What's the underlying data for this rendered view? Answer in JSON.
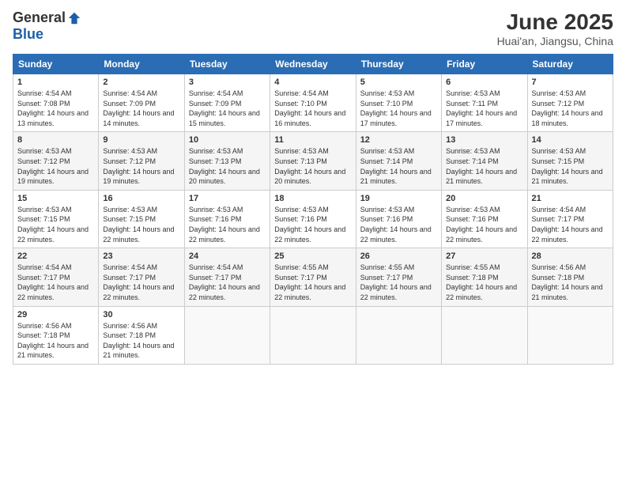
{
  "logo": {
    "general": "General",
    "blue": "Blue"
  },
  "title": "June 2025",
  "location": "Huai'an, Jiangsu, China",
  "days_of_week": [
    "Sunday",
    "Monday",
    "Tuesday",
    "Wednesday",
    "Thursday",
    "Friday",
    "Saturday"
  ],
  "weeks": [
    [
      {
        "day": "1",
        "sunrise": "4:54 AM",
        "sunset": "7:08 PM",
        "daylight": "14 hours and 13 minutes."
      },
      {
        "day": "2",
        "sunrise": "4:54 AM",
        "sunset": "7:09 PM",
        "daylight": "14 hours and 14 minutes."
      },
      {
        "day": "3",
        "sunrise": "4:54 AM",
        "sunset": "7:09 PM",
        "daylight": "14 hours and 15 minutes."
      },
      {
        "day": "4",
        "sunrise": "4:54 AM",
        "sunset": "7:10 PM",
        "daylight": "14 hours and 16 minutes."
      },
      {
        "day": "5",
        "sunrise": "4:53 AM",
        "sunset": "7:10 PM",
        "daylight": "14 hours and 17 minutes."
      },
      {
        "day": "6",
        "sunrise": "4:53 AM",
        "sunset": "7:11 PM",
        "daylight": "14 hours and 17 minutes."
      },
      {
        "day": "7",
        "sunrise": "4:53 AM",
        "sunset": "7:12 PM",
        "daylight": "14 hours and 18 minutes."
      }
    ],
    [
      {
        "day": "8",
        "sunrise": "4:53 AM",
        "sunset": "7:12 PM",
        "daylight": "14 hours and 19 minutes."
      },
      {
        "day": "9",
        "sunrise": "4:53 AM",
        "sunset": "7:12 PM",
        "daylight": "14 hours and 19 minutes."
      },
      {
        "day": "10",
        "sunrise": "4:53 AM",
        "sunset": "7:13 PM",
        "daylight": "14 hours and 20 minutes."
      },
      {
        "day": "11",
        "sunrise": "4:53 AM",
        "sunset": "7:13 PM",
        "daylight": "14 hours and 20 minutes."
      },
      {
        "day": "12",
        "sunrise": "4:53 AM",
        "sunset": "7:14 PM",
        "daylight": "14 hours and 21 minutes."
      },
      {
        "day": "13",
        "sunrise": "4:53 AM",
        "sunset": "7:14 PM",
        "daylight": "14 hours and 21 minutes."
      },
      {
        "day": "14",
        "sunrise": "4:53 AM",
        "sunset": "7:15 PM",
        "daylight": "14 hours and 21 minutes."
      }
    ],
    [
      {
        "day": "15",
        "sunrise": "4:53 AM",
        "sunset": "7:15 PM",
        "daylight": "14 hours and 22 minutes."
      },
      {
        "day": "16",
        "sunrise": "4:53 AM",
        "sunset": "7:15 PM",
        "daylight": "14 hours and 22 minutes."
      },
      {
        "day": "17",
        "sunrise": "4:53 AM",
        "sunset": "7:16 PM",
        "daylight": "14 hours and 22 minutes."
      },
      {
        "day": "18",
        "sunrise": "4:53 AM",
        "sunset": "7:16 PM",
        "daylight": "14 hours and 22 minutes."
      },
      {
        "day": "19",
        "sunrise": "4:53 AM",
        "sunset": "7:16 PM",
        "daylight": "14 hours and 22 minutes."
      },
      {
        "day": "20",
        "sunrise": "4:53 AM",
        "sunset": "7:16 PM",
        "daylight": "14 hours and 22 minutes."
      },
      {
        "day": "21",
        "sunrise": "4:54 AM",
        "sunset": "7:17 PM",
        "daylight": "14 hours and 22 minutes."
      }
    ],
    [
      {
        "day": "22",
        "sunrise": "4:54 AM",
        "sunset": "7:17 PM",
        "daylight": "14 hours and 22 minutes."
      },
      {
        "day": "23",
        "sunrise": "4:54 AM",
        "sunset": "7:17 PM",
        "daylight": "14 hours and 22 minutes."
      },
      {
        "day": "24",
        "sunrise": "4:54 AM",
        "sunset": "7:17 PM",
        "daylight": "14 hours and 22 minutes."
      },
      {
        "day": "25",
        "sunrise": "4:55 AM",
        "sunset": "7:17 PM",
        "daylight": "14 hours and 22 minutes."
      },
      {
        "day": "26",
        "sunrise": "4:55 AM",
        "sunset": "7:17 PM",
        "daylight": "14 hours and 22 minutes."
      },
      {
        "day": "27",
        "sunrise": "4:55 AM",
        "sunset": "7:18 PM",
        "daylight": "14 hours and 22 minutes."
      },
      {
        "day": "28",
        "sunrise": "4:56 AM",
        "sunset": "7:18 PM",
        "daylight": "14 hours and 21 minutes."
      }
    ],
    [
      {
        "day": "29",
        "sunrise": "4:56 AM",
        "sunset": "7:18 PM",
        "daylight": "14 hours and 21 minutes."
      },
      {
        "day": "30",
        "sunrise": "4:56 AM",
        "sunset": "7:18 PM",
        "daylight": "14 hours and 21 minutes."
      },
      null,
      null,
      null,
      null,
      null
    ]
  ]
}
